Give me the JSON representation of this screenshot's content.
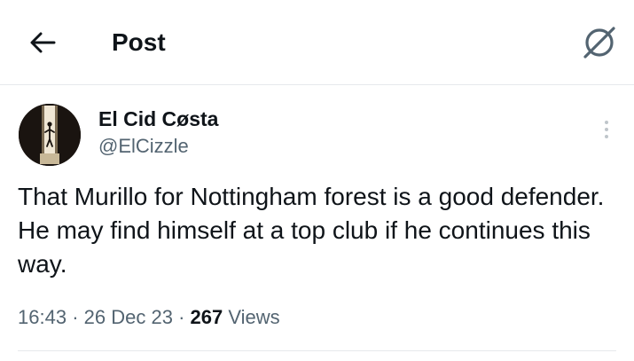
{
  "header": {
    "title": "Post",
    "back_icon": "arrow-left-icon",
    "grok_icon": "grok-icon"
  },
  "tweet": {
    "author": {
      "display_name": "El Cid Cøsta",
      "handle": "@ElCizzle"
    },
    "text": "That Murillo for Nottingham forest is a good defender. He may find himself at a top club if he continues this way.",
    "meta": {
      "time": "16:43",
      "separator": "·",
      "date": "26 Dec 23",
      "views_count": "267",
      "views_label": "Views"
    },
    "more_icon": "more-vertical-icon"
  },
  "colors": {
    "text_primary": "#0f1419",
    "text_secondary": "#536471",
    "divider": "#e6e9ec"
  }
}
